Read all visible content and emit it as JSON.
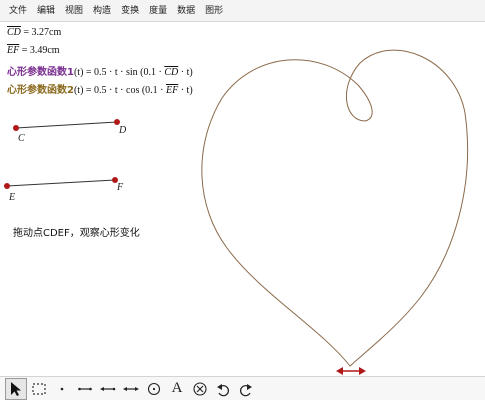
{
  "menu": [
    "文件",
    "编辑",
    "视图",
    "构造",
    "变换",
    "度量",
    "数据",
    "图形"
  ],
  "measurements": [
    {
      "segment": "CD",
      "value": "= 3.27cm"
    },
    {
      "segment": "EF",
      "value": "= 3.49cm"
    }
  ],
  "params": [
    {
      "label": "心形参数函数1",
      "arg": "(t)",
      "expr_pre": " = 0.5 · t · sin (0.1 · ",
      "seg": "CD",
      "expr_post": " · t)"
    },
    {
      "label": "心形参数函数2",
      "arg": "(t)",
      "expr_pre": " = 0.5 · t · cos (0.1 · ",
      "seg": "EF",
      "expr_post": " · t)"
    }
  ],
  "points": {
    "C": "C",
    "D": "D",
    "E": "E",
    "F": "F"
  },
  "hint": "拖动点CDEF，观察心形变化",
  "colors": {
    "point": "#b01818",
    "curve": "#8b6a4a",
    "param1": "#7a2f8f",
    "param2": "#8a6a1f"
  },
  "toolbar": [
    {
      "name": "select-arrow-tool",
      "active": true
    },
    {
      "name": "marquee-tool",
      "active": false
    },
    {
      "name": "point-tool",
      "active": false
    },
    {
      "name": "segment-tool",
      "active": false
    },
    {
      "name": "ray-tool",
      "active": false
    },
    {
      "name": "line-tool",
      "active": false
    },
    {
      "name": "compass-circle-tool",
      "active": false
    },
    {
      "name": "text-tool",
      "active": false
    },
    {
      "name": "delete-tool",
      "active": false
    },
    {
      "name": "undo-tool",
      "active": false
    },
    {
      "name": "redo-tool",
      "active": false
    }
  ],
  "text_tool_glyph": "A"
}
